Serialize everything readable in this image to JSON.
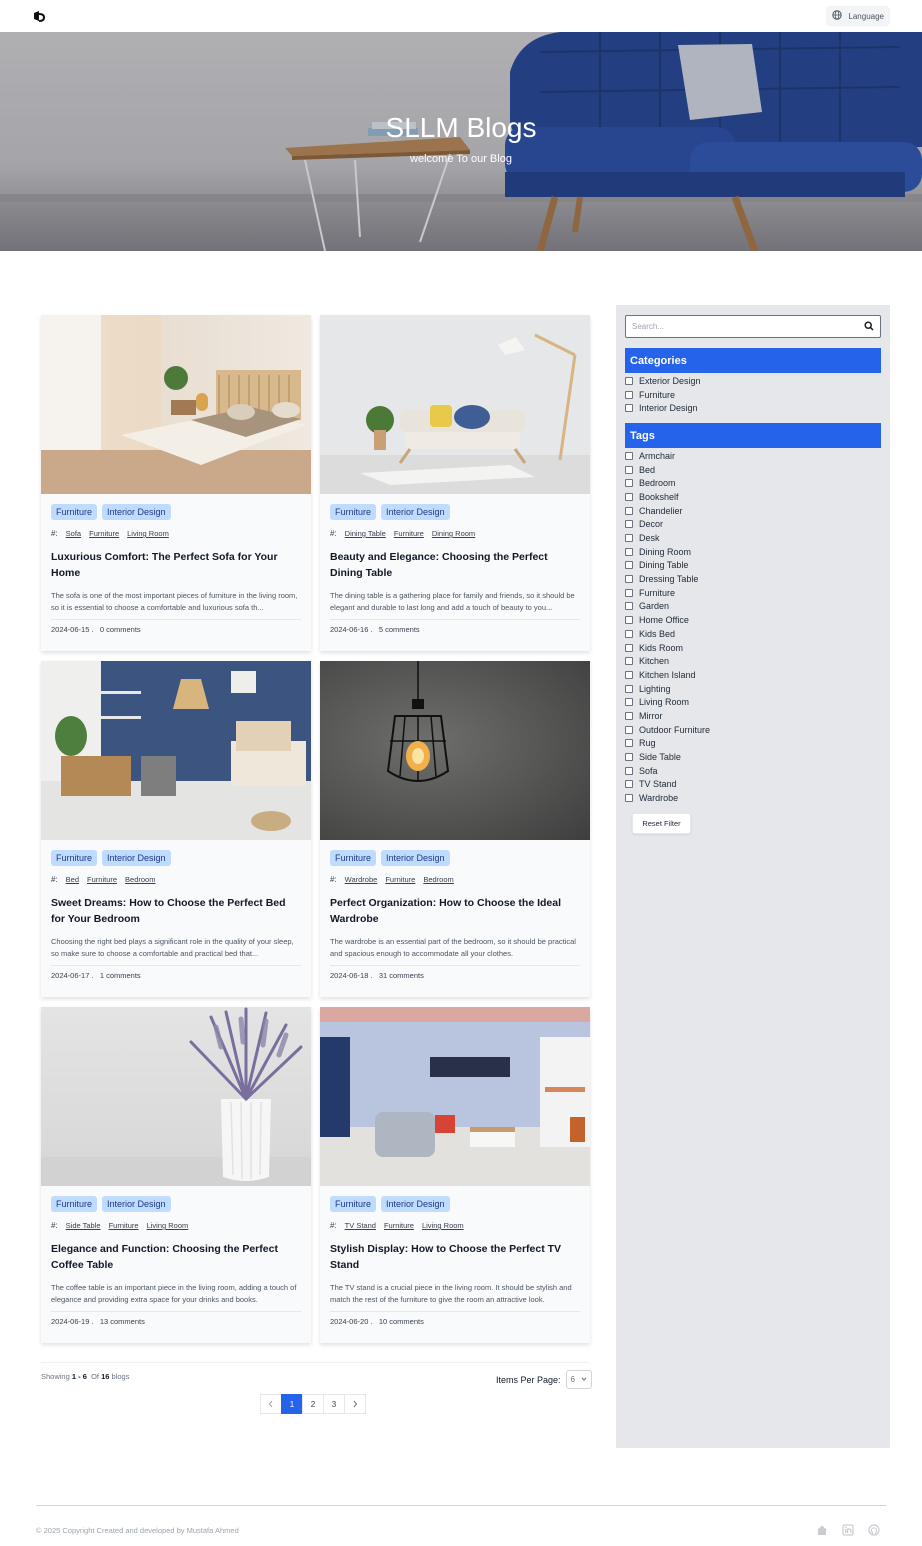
{
  "header": {
    "language_label": "Language"
  },
  "hero": {
    "title": "SLLM Blogs",
    "subtitle": "welcome To our Blog"
  },
  "posts": [
    {
      "categories": [
        "Furniture",
        "Interior Design"
      ],
      "tags": [
        "Sofa",
        "Furniture",
        "Living Room"
      ],
      "title": "Luxurious Comfort: The Perfect Sofa for Your Home",
      "excerpt": "The sofa is one of the most important pieces of furniture in the living room, so it is essential to choose a comfortable and luxurious sofa th...",
      "date": "2024-06-15 .",
      "comments": "0 comments",
      "image": "bedroom-photo"
    },
    {
      "categories": [
        "Furniture",
        "Interior Design"
      ],
      "tags": [
        "Dining Table",
        "Furniture",
        "Dining Room"
      ],
      "title": "Beauty and Elegance: Choosing the Perfect Dining Table",
      "excerpt": "The dining table is a gathering place for family and friends, so it should be elegant and durable to last long and add a touch of beauty to you...",
      "date": "2024-06-16 .",
      "comments": "5 comments",
      "image": "sofa-lamp-photo"
    },
    {
      "categories": [
        "Furniture",
        "Interior Design"
      ],
      "tags": [
        "Bed",
        "Furniture",
        "Bedroom"
      ],
      "title": "Sweet Dreams: How to Choose the Perfect Bed for Your Bedroom",
      "excerpt": "Choosing the right bed plays a significant role in the quality of your sleep, so make sure to choose a comfortable and practical bed that...",
      "date": "2024-06-17 .",
      "comments": "1 comments",
      "image": "blue-bedroom-photo"
    },
    {
      "categories": [
        "Furniture",
        "Interior Design"
      ],
      "tags": [
        "Wardrobe",
        "Furniture",
        "Bedroom"
      ],
      "title": "Perfect Organization: How to Choose the Ideal Wardrobe",
      "excerpt": "The wardrobe is an essential part of the bedroom, so it should be practical and spacious enough to accommodate all your clothes.",
      "date": "2024-06-18 .",
      "comments": "31 comments",
      "image": "pendant-lamp-photo"
    },
    {
      "categories": [
        "Furniture",
        "Interior Design"
      ],
      "tags": [
        "Side Table",
        "Furniture",
        "Living Room"
      ],
      "title": "Elegance and Function: Choosing the Perfect Coffee Table",
      "excerpt": "The coffee table is an important piece in the living room, adding a touch of elegance and providing extra space for your drinks and books.",
      "date": "2024-06-19 .",
      "comments": "13 comments",
      "image": "lavender-vase-photo"
    },
    {
      "categories": [
        "Furniture",
        "Interior Design"
      ],
      "tags": [
        "TV Stand",
        "Furniture",
        "Living Room"
      ],
      "title": "Stylish Display: How to Choose the Perfect TV Stand",
      "excerpt": "The TV stand is a crucial piece in the living room. It should be stylish and match the rest of the furniture to give the room an attractive look.",
      "date": "2024-06-20 .",
      "comments": "10 comments",
      "image": "living-room-photo"
    }
  ],
  "pagination": {
    "showing_prefix": "Showing",
    "range_start": "1",
    "range_sep": "-",
    "range_end": "6",
    "of_label": "Of",
    "total": "16",
    "suffix": "blogs",
    "items_per_page_label": "Items Per Page:",
    "items_per_page_value": "6",
    "pages": [
      "1",
      "2",
      "3"
    ],
    "current_page": "1"
  },
  "sidebar": {
    "search_placeholder": "Search...",
    "categories_title": "Categories",
    "categories": [
      "Exterior Design",
      "Furniture",
      "Interior Design"
    ],
    "tags_title": "Tags",
    "tags": [
      "Armchair",
      "Bed",
      "Bedroom",
      "Bookshelf",
      "Chandelier",
      "Decor",
      "Desk",
      "Dining Room",
      "Dining Table",
      "Dressing Table",
      "Furniture",
      "Garden",
      "Home Office",
      "Kids Bed",
      "Kids Room",
      "Kitchen",
      "Kitchen Island",
      "Lighting",
      "Living Room",
      "Mirror",
      "Outdoor Furniture",
      "Rug",
      "Side Table",
      "Sofa",
      "TV Stand",
      "Wardrobe"
    ],
    "reset_label": "Reset Filter"
  },
  "footer": {
    "copyright": "© 2025 Copyright Created and developed by Mustafa Ahmed",
    "icons": [
      "home-icon",
      "linkedin-icon",
      "github-icon"
    ]
  },
  "colors": {
    "accent": "#2563eb",
    "badge_bg": "#bfdbfe",
    "sidebar_bg": "#e5e7eb",
    "hero_sofa": "#1e3f8a"
  }
}
